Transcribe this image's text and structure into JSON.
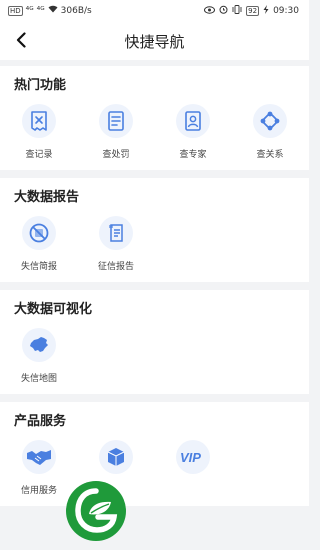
{
  "status_bar": {
    "left_badge": "HD",
    "signal1": "⁴ᴳ",
    "signal2": "⁴ᴳ",
    "network_speed": "306B/s",
    "battery": "92",
    "time": "09:30"
  },
  "header": {
    "title": "快捷导航"
  },
  "sections": [
    {
      "title": "热门功能",
      "items": [
        {
          "label": "查记录",
          "icon": "record-icon"
        },
        {
          "label": "查处罚",
          "icon": "penalty-doc-icon"
        },
        {
          "label": "查专家",
          "icon": "expert-icon"
        },
        {
          "label": "查关系",
          "icon": "relation-icon"
        }
      ]
    },
    {
      "title": "大数据报告",
      "items": [
        {
          "label": "失信简报",
          "icon": "brief-report-icon"
        },
        {
          "label": "征信报告",
          "icon": "credit-report-icon"
        }
      ]
    },
    {
      "title": "大数据可视化",
      "items": [
        {
          "label": "失信地图",
          "icon": "china-map-icon"
        }
      ]
    },
    {
      "title": "产品服务",
      "items": [
        {
          "label": "信用服务",
          "icon": "handshake-icon"
        },
        {
          "label": "",
          "icon": "cube-icon"
        },
        {
          "label": "",
          "icon": "vip-icon"
        }
      ]
    }
  ],
  "colors": {
    "accent": "#4a7fe0",
    "icon_bg": "#eef3fc",
    "page_bg": "#f2f3f5",
    "logo_green": "#1f9a3a"
  }
}
